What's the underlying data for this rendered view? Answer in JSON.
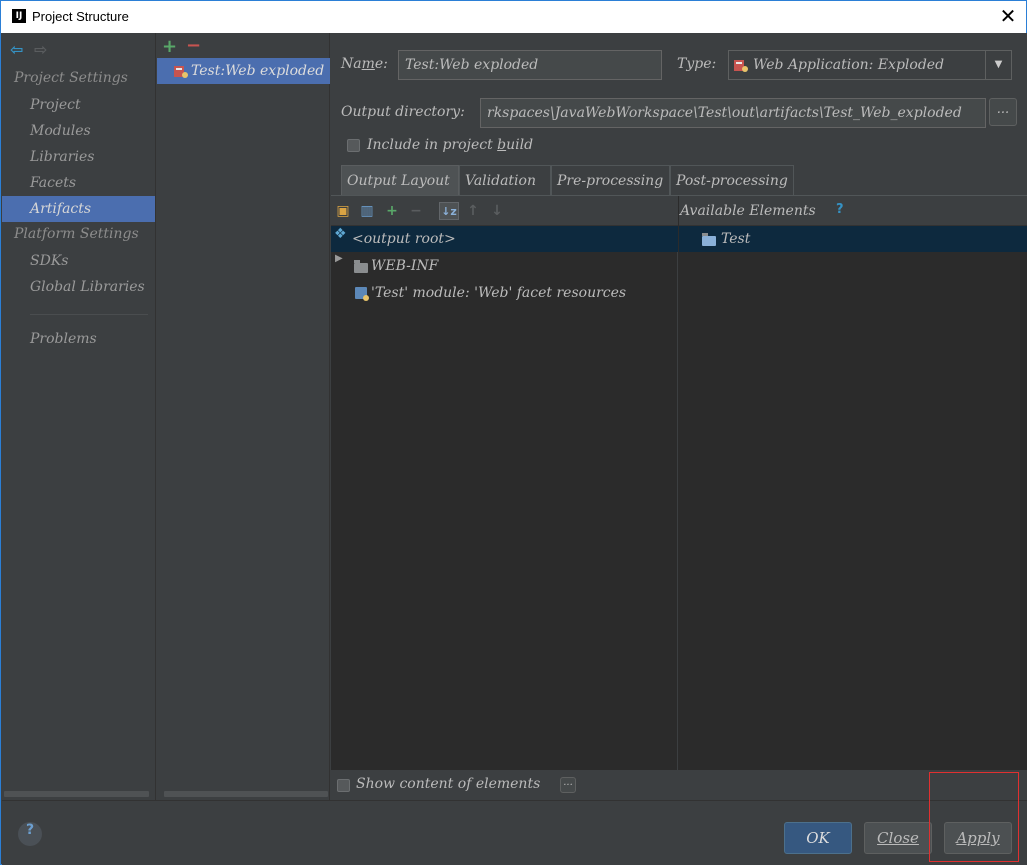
{
  "window": {
    "title": "Project Structure",
    "app_icon": "IJ"
  },
  "nav": {
    "sections": [
      {
        "label": "Project Settings",
        "items": [
          "Project",
          "Modules",
          "Libraries",
          "Facets",
          "Artifacts"
        ]
      },
      {
        "label": "Platform Settings",
        "items": [
          "SDKs",
          "Global Libraries"
        ]
      }
    ],
    "problems": "Problems",
    "selected": "Artifacts"
  },
  "artifacts": {
    "items": [
      "Test:Web exploded"
    ]
  },
  "form": {
    "name_label_pre": "Na",
    "name_label_u": "m",
    "name_label_post": "e:",
    "name_value": "Test:Web exploded",
    "type_label": "Type:",
    "type_value": "Web Application: Exploded",
    "output_label": "Output directory:",
    "output_value": "rkspaces\\JavaWebWorkspace\\Test\\out\\artifacts\\Test_Web_exploded",
    "browse": "...",
    "include_pre": "Include in project ",
    "include_u": "b",
    "include_post": "uild"
  },
  "tabs": [
    "Output Layout",
    "Validation",
    "Pre-processing",
    "Post-processing"
  ],
  "layout": {
    "available_label": "Available Elements",
    "help_mark": "?",
    "tree": [
      "<output root>",
      "WEB-INF",
      "'Test' module: 'Web' facet resources"
    ],
    "available": [
      "Test"
    ],
    "show_content": "Show content of elements"
  },
  "footer": {
    "help": "?",
    "ok": "OK",
    "close": "Close",
    "apply": "Apply"
  },
  "colors": {
    "accent": "#4b6eaf",
    "primary_button": "#365880",
    "highlight_box": "#e03030"
  }
}
